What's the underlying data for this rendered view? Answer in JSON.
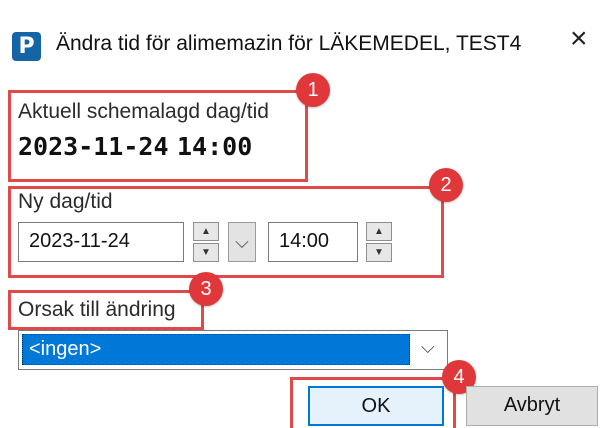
{
  "window": {
    "app_icon_letter": "P",
    "title": "Ändra tid för alimemazin för LÄKEMEDEL, TEST4",
    "close_glyph": "×"
  },
  "current": {
    "label": "Aktuell schemalagd dag/tid",
    "date": "2023-11-24",
    "time": "14:00"
  },
  "new_time": {
    "label": "Ny dag/tid",
    "date_value": "2023-11-24",
    "time_value": "14:00"
  },
  "reason": {
    "label": "Orsak till ändring",
    "selected": "<ingen>"
  },
  "buttons": {
    "ok": "OK",
    "cancel": "Avbryt"
  },
  "annotations": {
    "badge_1": "1",
    "badge_2": "2",
    "badge_3": "3",
    "badge_4": "4",
    "color": "#e04a4a"
  },
  "icons": {
    "spin_up": "▲",
    "spin_down": "▼",
    "chevron": "⌵"
  }
}
